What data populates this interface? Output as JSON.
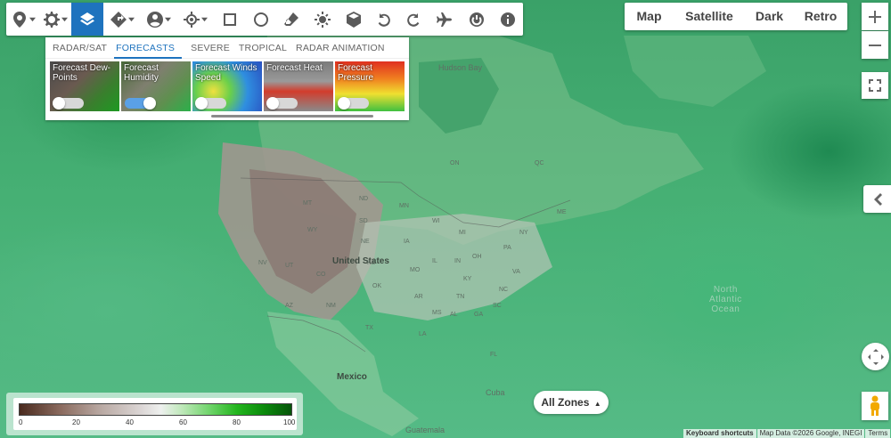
{
  "toolbar": {
    "tools": [
      {
        "icon": "location-pin-icon",
        "dropdown": true
      },
      {
        "icon": "gear-icon",
        "dropdown": true
      },
      {
        "icon": "layers-icon",
        "active": true
      },
      {
        "icon": "directions-icon",
        "dropdown": true
      },
      {
        "icon": "person-icon",
        "dropdown": true
      },
      {
        "icon": "my-location-icon",
        "dropdown": true
      },
      {
        "icon": "square-icon"
      },
      {
        "icon": "circle-icon"
      },
      {
        "icon": "eraser-icon"
      },
      {
        "icon": "sun-icon"
      },
      {
        "icon": "cube-icon"
      },
      {
        "icon": "undo-icon"
      },
      {
        "icon": "redo-icon"
      },
      {
        "icon": "airplane-icon"
      },
      {
        "icon": "power-icon"
      },
      {
        "icon": "info-icon"
      }
    ]
  },
  "panel": {
    "tabs": [
      {
        "label": "RADAR/SAT",
        "active": false
      },
      {
        "label": "FORECASTS",
        "active": true
      },
      {
        "label": "SEVERE",
        "active": false
      },
      {
        "label": "TROPICAL",
        "active": false
      },
      {
        "label": "RADAR ANIMATION",
        "active": false
      }
    ],
    "cards": [
      {
        "title": "Forecast Dew-Points",
        "on": false
      },
      {
        "title": "Forecast Humidity",
        "on": true
      },
      {
        "title": "Forecast Winds Speed",
        "on": false
      },
      {
        "title": "Forecast Heat",
        "on": false
      },
      {
        "title": "Forecast Pressure",
        "on": false
      }
    ]
  },
  "maptype": {
    "options": [
      "Map",
      "Satellite",
      "Dark",
      "Retro"
    ]
  },
  "map": {
    "labels": {
      "hudson_bay": "Hudson Bay",
      "united_states": "United States",
      "mexico": "Mexico",
      "cuba": "Cuba",
      "guatemala": "Guatemala",
      "north_atlantic": "North\nAtlantic\nOcean",
      "states": [
        "MT",
        "ND",
        "SD",
        "WY",
        "NE",
        "NV",
        "UT",
        "CO",
        "KS",
        "AZ",
        "NM",
        "OK",
        "TX",
        "MN",
        "IA",
        "MO",
        "WI",
        "MI",
        "IL",
        "IN",
        "OH",
        "KY",
        "TN",
        "AR",
        "MS",
        "AL",
        "GA",
        "SC",
        "NC",
        "VA",
        "PA",
        "NY",
        "ME",
        "FL",
        "LA",
        "QC",
        "ON"
      ]
    }
  },
  "legend": {
    "ticks": [
      "0",
      "20",
      "40",
      "60",
      "80",
      "100"
    ]
  },
  "zones": {
    "label": "All Zones"
  },
  "attribution": {
    "shortcuts": "Keyboard shortcuts",
    "mapdata": "Map Data ©2026 Google, INEGI",
    "terms": "Terms"
  },
  "colors": {
    "accent": "#1e73be",
    "map_green": "#3aa86a"
  }
}
